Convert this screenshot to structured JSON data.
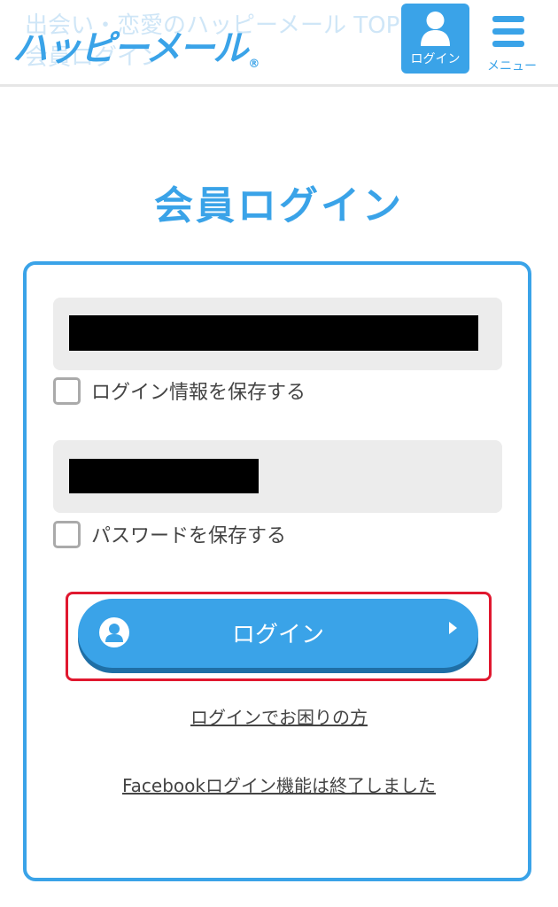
{
  "header": {
    "background_text_line1": "出会い・恋愛のハッピーメール TOP",
    "background_text_line2": "会員ログイン",
    "logo_text": "ハッピーメール",
    "logo_mark": "®",
    "login_tile_label": "ログイン",
    "menu_label": "メニュー",
    "login_icon": "person-icon",
    "menu_icon": "hamburger-icon"
  },
  "main": {
    "title": "会員ログイン",
    "id_field_value": "",
    "password_field_value": "",
    "save_login_label": "ログイン情報を保存する",
    "save_password_label": "パスワードを保存する",
    "login_button_label": "ログイン",
    "trouble_link": "ログインでお困りの方",
    "facebook_notice_link": "Facebookログイン機能は終了しました"
  },
  "colors": {
    "accent": "#3aa3e8",
    "highlight": "#e0182f",
    "field_bg": "#ececec"
  }
}
